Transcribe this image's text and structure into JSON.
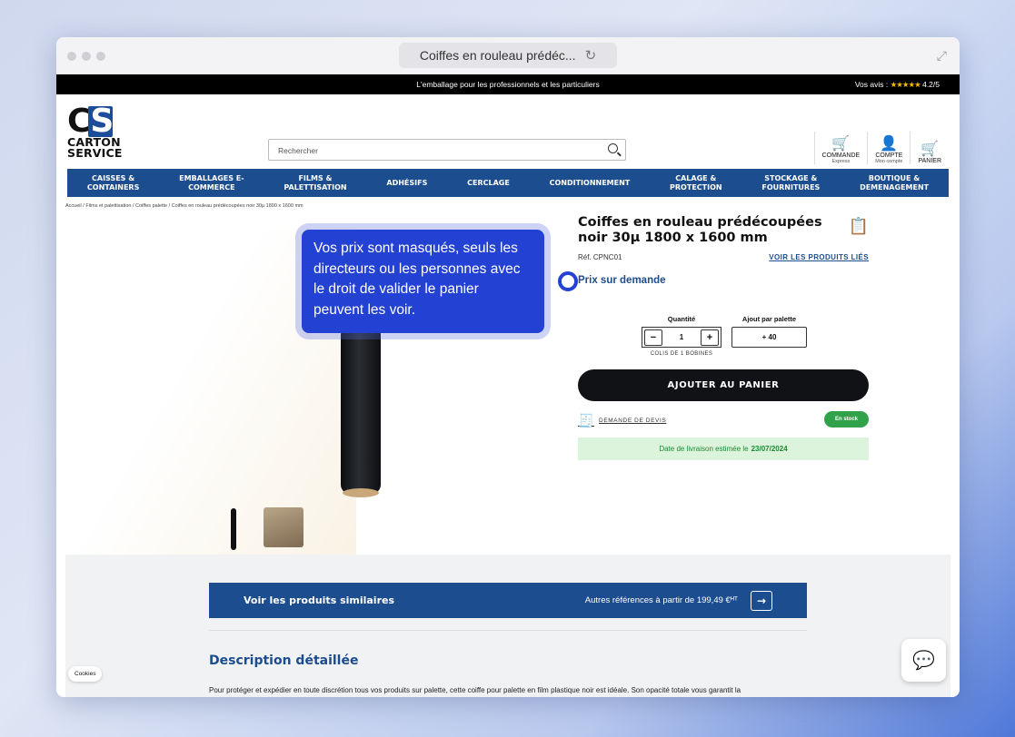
{
  "browser": {
    "tab_title": "Coiffes en rouleau prédéc...",
    "reload_icon": "reload-icon",
    "expand_icon": "expand-icon"
  },
  "promo": {
    "text": "L'emballage pour les professionnels et les particuliers",
    "reviews_label": "Vos avis :",
    "stars": "★★★★★",
    "rating": "4.2/5"
  },
  "logo": {
    "line1": "CARTON",
    "line2": "SERVICE",
    "mark": "CS"
  },
  "search": {
    "placeholder": "Rechercher"
  },
  "actions": [
    {
      "label": "COMMANDE",
      "sub": "Express",
      "icon": "cart-clock-icon"
    },
    {
      "label": "COMPTE",
      "sub": "Mon compte",
      "icon": "user-icon"
    },
    {
      "label": "PANIER",
      "sub": "",
      "icon": "cart-icon"
    }
  ],
  "nav": [
    "CAISSES &\nCONTAINERS",
    "EMBALLAGES E-\nCOMMERCE",
    "FILMS &\nPALETTISATION",
    "ADHÉSIFS",
    "CERCLAGE",
    "CONDITIONNEMENT",
    "CALAGE &\nPROTECTION",
    "STOCKAGE &\nFOURNITURES",
    "BOUTIQUE &\nDEMENAGEMENT"
  ],
  "breadcrumb": "Accueil / Films et palettisation / Coiffes palette / Coiffes en rouleau prédécoupées noir 30µ 1800 x 1600 mm",
  "tooltip": "Vos prix sont masqués, seuls les directeurs ou les personnes avec le droit de valider le panier peuvent les voir.",
  "product": {
    "title": "Coiffes en rouleau prédécoupées noir 30µ 1800 x 1600 mm",
    "ref": "Réf. CPNC01",
    "related_link": "VOIR LES PRODUITS LIÉS",
    "price": "Prix sur demande",
    "qty_label": "Quantité",
    "qty_value": "1",
    "minus": "−",
    "plus": "+",
    "colis": "COLIS DE 1 BOBINES",
    "pallet_label": "Ajout par palette",
    "pallet_value": "+ 40",
    "add_to_cart": "AJOUTER AU PANIER",
    "quote": "DEMANDE DE DEVIS",
    "stock": "En stock",
    "delivery_label": "Date de livraison estimée le",
    "delivery_date": "23/07/2024"
  },
  "similar": {
    "label": "Voir les produits similaires",
    "other": "Autres références à partir de 199,49 €ᴴᵀ",
    "arrow": "→"
  },
  "description": {
    "title": "Description détaillée",
    "text": "Pour protéger et expédier en toute discrétion tous vos produits sur palette, cette coiffe pour palette en film plastique noir est idéale. Son opacité totale vous garantit la"
  },
  "cookies": "Cookies"
}
